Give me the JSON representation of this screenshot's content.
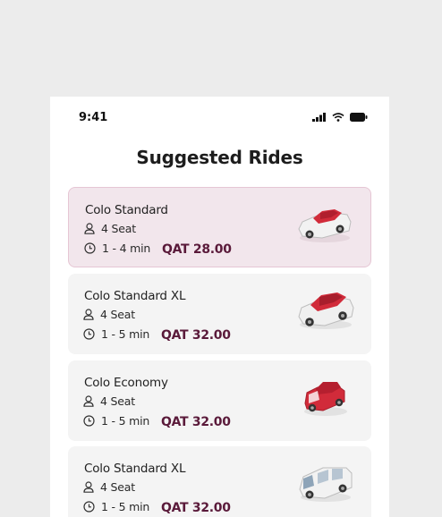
{
  "status_bar": {
    "time": "9:41"
  },
  "page": {
    "title": "Suggested Rides"
  },
  "rides": [
    {
      "name": "Colo Standard",
      "seats": "4 Seat",
      "eta": "1 - 4 min",
      "price": "QAT 28.00",
      "selected": true,
      "car_icon": "sedan-icon"
    },
    {
      "name": "Colo Standard XL",
      "seats": "4 Seat",
      "eta": "1 - 5 min",
      "price": "QAT 32.00",
      "selected": false,
      "car_icon": "sedan-icon"
    },
    {
      "name": "Colo Economy",
      "seats": "4 Seat",
      "eta": "1 - 5 min",
      "price": "QAT 32.00",
      "selected": false,
      "car_icon": "hatchback-icon"
    },
    {
      "name": "Colo Standard XL",
      "seats": "4 Seat",
      "eta": "1 - 5 min",
      "price": "QAT 32.00",
      "selected": false,
      "car_icon": "van-icon"
    }
  ],
  "colors": {
    "accent": "#5a1a3a",
    "selected_bg": "#f2e6ec",
    "card_bg": "#f4f4f4",
    "car_roof": "#d12b3a"
  }
}
